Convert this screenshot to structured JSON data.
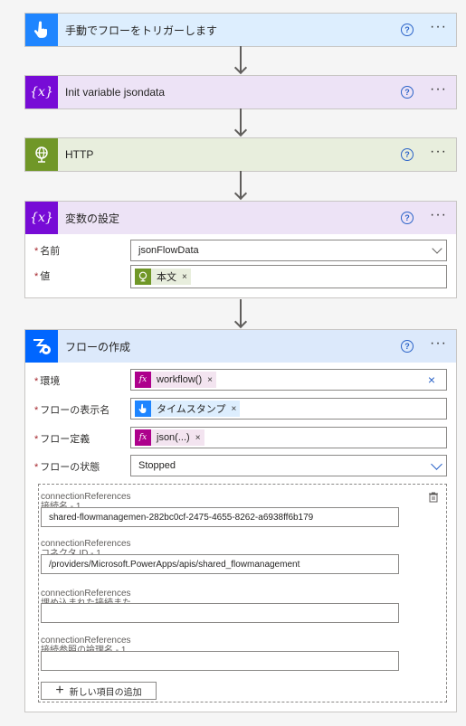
{
  "cards": {
    "trigger": {
      "title": "手動でフローをトリガーします",
      "help": "?",
      "more": "···"
    },
    "init": {
      "title": "Init variable jsondata",
      "help": "?",
      "more": "···",
      "icon": "{x}"
    },
    "http": {
      "title": "HTTP",
      "help": "?",
      "more": "···"
    },
    "setvar": {
      "title": "変数の設定",
      "help": "?",
      "more": "···",
      "icon": "{x}",
      "name_label": "名前",
      "name_value": "jsonFlowData",
      "value_label": "値",
      "value_token": "本文",
      "token_close": "×"
    },
    "createflow": {
      "title": "フローの作成",
      "help": "?",
      "more": "···",
      "env_label": "環境",
      "env_token": "workflow()",
      "env_clear": "×",
      "display_label": "フローの表示名",
      "display_token": "タイムスタンプ",
      "def_label": "フロー定義",
      "def_token": "json(...)",
      "state_label": "フローの状態",
      "state_value": "Stopped",
      "token_close": "×",
      "fx": "fx",
      "refs": [
        {
          "label": "connectionReferences\n接続名 - 1",
          "value": "shared-flowmanagemen-282bc0cf-2475-4655-8262-a6938ff6b179"
        },
        {
          "label": "connectionReferences\nコネクタ ID - 1",
          "value": "/providers/Microsoft.PowerApps/apis/shared_flowmanagement"
        },
        {
          "label": "connectionReferences\n埋め込まれた接続また",
          "value": ""
        },
        {
          "label": "connectionReferences\n接続参照の論理名 - 1",
          "value": ""
        }
      ],
      "add_item": "新しい項目の追加",
      "add_plus": "+"
    }
  },
  "colors": {
    "trigger_header": "#ddeefe",
    "trigger_icon": "#1f85ff",
    "variable_header": "#ede3f6",
    "variable_icon": "#770bd6",
    "http_header": "#e8eedd",
    "http_icon": "#709727",
    "flow_header": "#dce9fb",
    "flow_icon": "#0066ff",
    "fx_token": "#ad008c"
  }
}
